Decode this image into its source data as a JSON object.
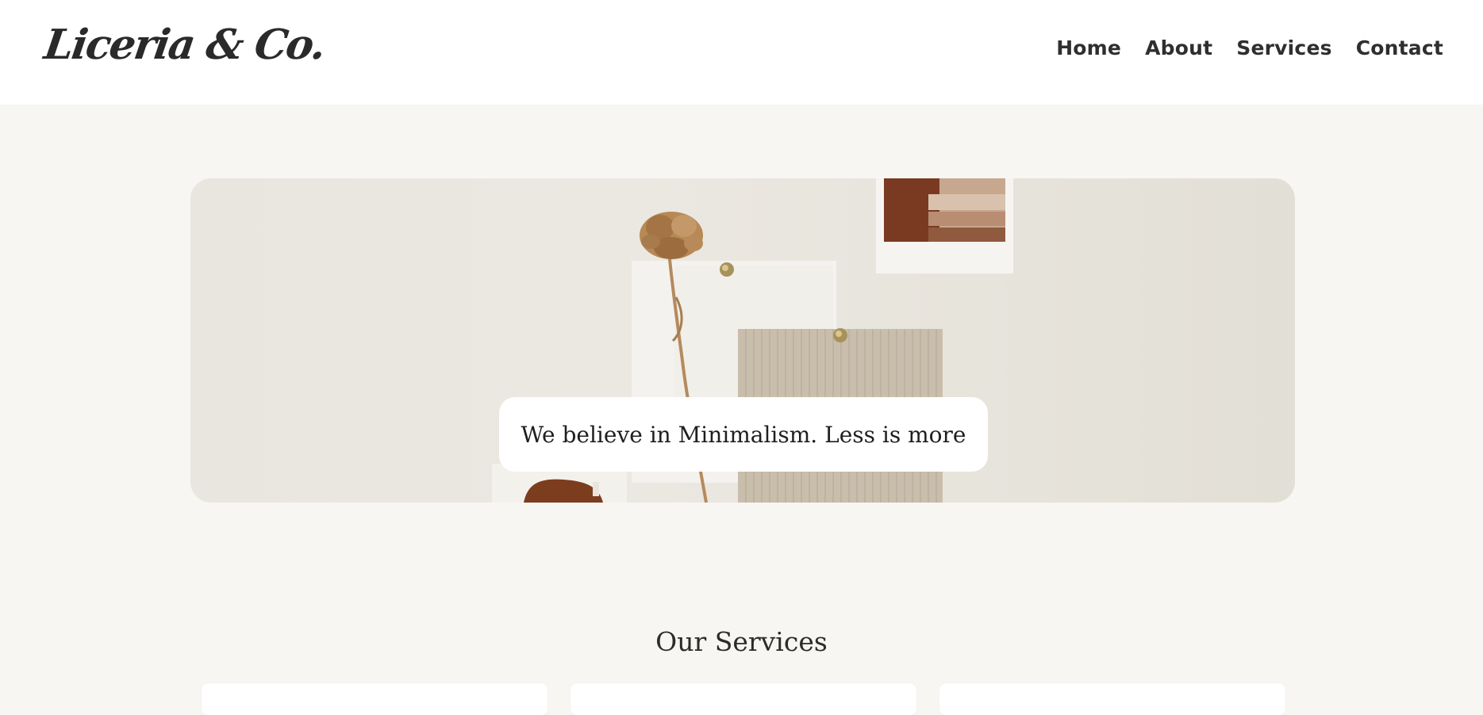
{
  "header": {
    "logo_text": "Liceria & Co.",
    "nav": [
      {
        "label": "Home"
      },
      {
        "label": "About"
      },
      {
        "label": "Services"
      },
      {
        "label": "Contact"
      }
    ]
  },
  "hero": {
    "tagline": "We believe in Minimalism. Less is more"
  },
  "services": {
    "title": "Our Services"
  },
  "colors": {
    "page_bg": "#f7f6f3",
    "header_bg": "#ffffff",
    "text": "#2b2b2b",
    "accent_brown": "#8a4a2a"
  }
}
